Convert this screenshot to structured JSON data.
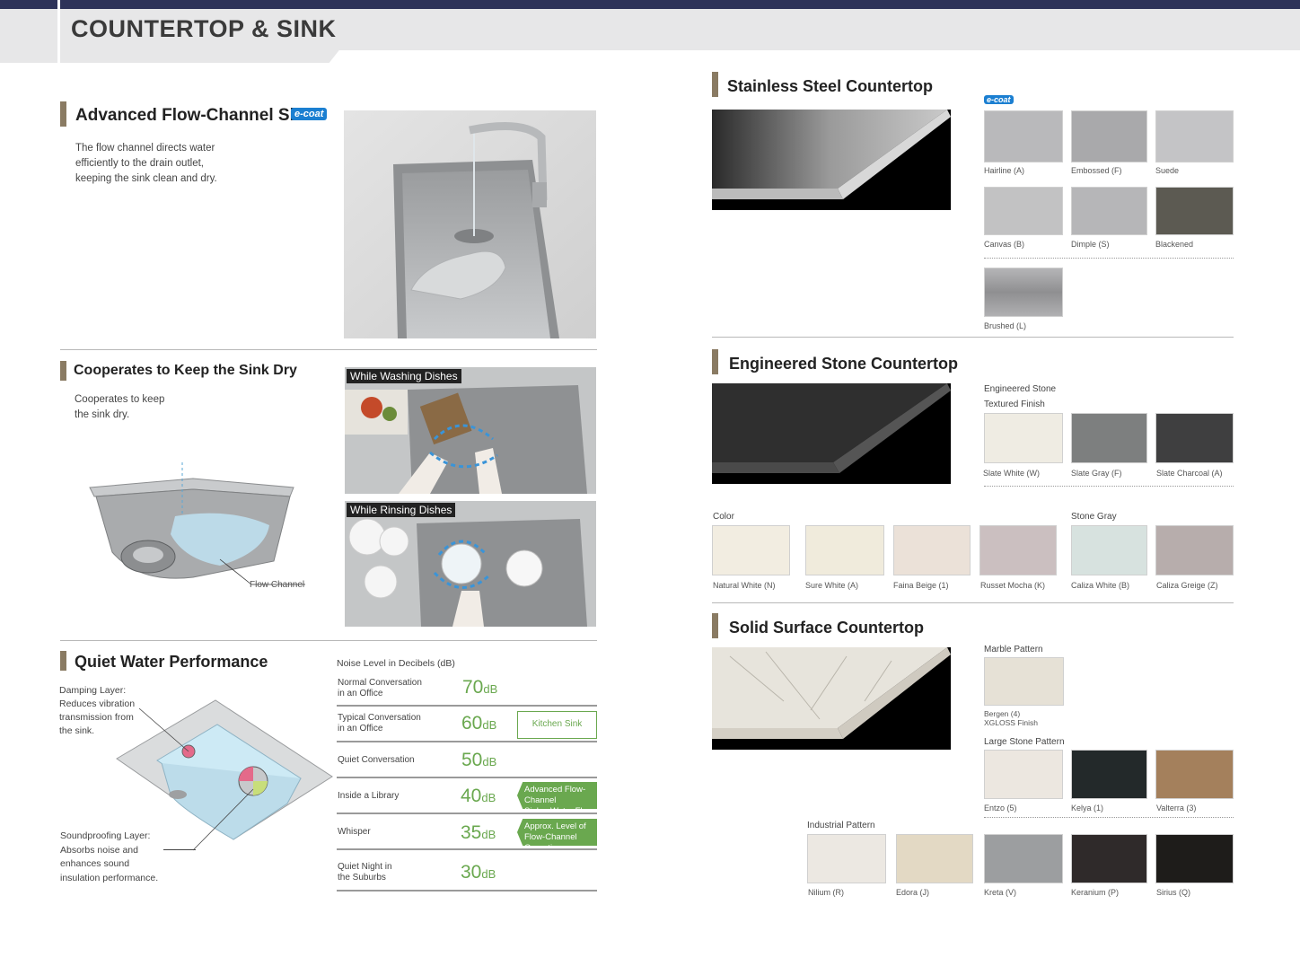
{
  "header": {
    "title": "COUNTERTOP & SINK"
  },
  "colors": {
    "accent_bar": "#8a7b63",
    "green": "#6aa84f",
    "ecoat_blue": "#1b7fd1",
    "top_bar": "#2e3359"
  },
  "flow_sink": {
    "title": "Advanced Flow-Channel Sink",
    "badge": "e-coat",
    "desc": [
      "The flow channel directs water",
      "efficiently to the drain outlet,",
      "keeping the sink clean and dry."
    ]
  },
  "keep_dry": {
    "title": "Cooperates to Keep the Sink Dry",
    "desc": [
      "Cooperates to keep",
      "the sink dry."
    ],
    "flow_channel_label": "Flow Channel",
    "photo1_label": "While Washing Dishes",
    "photo2_label": "While Rinsing Dishes"
  },
  "quiet": {
    "title": "Quiet Water Performance",
    "damping": [
      "Damping Layer:",
      "Reduces vibration",
      "transmission from",
      "the sink."
    ],
    "soundproof": [
      "Soundproofing Layer:",
      "Absorbs noise and",
      "enhances sound",
      "insulation performance."
    ],
    "table_title": "Noise Level in Decibels (dB)",
    "rows": [
      {
        "label": [
          "Normal Conversation",
          "in an Office"
        ],
        "value": "70",
        "unit": "dB"
      },
      {
        "label": [
          "Typical Conversation",
          "in an Office"
        ],
        "value": "60",
        "unit": "dB",
        "tag": "Kitchen Sink"
      },
      {
        "label": [
          "Quiet Conversation"
        ],
        "value": "50",
        "unit": "dB"
      },
      {
        "label": [
          "Inside a Library"
        ],
        "value": "40",
        "unit": "dB",
        "tag": [
          "Advanced Flow-Channel",
          "Sink – Water Flow"
        ]
      },
      {
        "label": [
          "Whisper"
        ],
        "value": "35",
        "unit": "dB",
        "tag": [
          "Approx. Level of",
          "Flow-Channel Operation"
        ]
      },
      {
        "label": [
          "Quiet Night in",
          "the Suburbs"
        ],
        "value": "30",
        "unit": "dB"
      }
    ]
  },
  "stainless": {
    "title": "Stainless Steel Countertop",
    "badge": "e-coat",
    "finishes": [
      {
        "name": "Hairline (A)",
        "color": "#b9b9bb"
      },
      {
        "name": "Embossed (F)",
        "color": "#a9a9ab"
      },
      {
        "name": "Suede",
        "color": "#c4c4c6"
      },
      {
        "name": "Canvas (B)",
        "color": "#c2c2c3"
      },
      {
        "name": "Dimple (S)",
        "color": "#b6b6b8"
      },
      {
        "name": "Blackened",
        "color": "#5c5a52"
      },
      {
        "name": "Brushed (L)",
        "color": "#a3a3a5"
      }
    ]
  },
  "engineered": {
    "title": "Engineered Stone Countertop",
    "sub": [
      "Engineered Stone",
      "Textured Finish"
    ],
    "textured": [
      {
        "name": "Slate White (W)",
        "color": "#efece3"
      },
      {
        "name": "Slate Gray (F)",
        "color": "#7d7f7f"
      },
      {
        "name": "Slate Charcoal (A)",
        "color": "#3f3f40"
      }
    ],
    "color_label": "Color",
    "stone_gray_label": "Stone Gray",
    "colors_list": [
      {
        "name": "Natural White (N)",
        "color": "#f2ede1"
      },
      {
        "name": "Sure White (A)",
        "color": "#f0ebdc"
      },
      {
        "name": "Faina Beige (1)",
        "color": "#ebe1d8"
      },
      {
        "name": "Russet Mocha (K)",
        "color": "#cbbfc0"
      },
      {
        "name": "Caliza White (B)",
        "color": "#d7e2df"
      },
      {
        "name": "Caliza Greige (Z)",
        "color": "#b7adac"
      }
    ]
  },
  "solid": {
    "title": "Solid Surface Countertop",
    "marble_label": "Marble Pattern",
    "marble": {
      "name": "Bergen (4)",
      "sub": "XGLOSS Finish",
      "color": "#e6e1d6"
    },
    "large_label": "Large Stone Pattern",
    "large": [
      {
        "name": "Entzo (5)",
        "color": "#ece7e0"
      },
      {
        "name": "Kelya (1)",
        "color": "#23292a"
      },
      {
        "name": "Valterra (3)",
        "color": "#a4805c"
      }
    ],
    "industrial_label": "Industrial Pattern",
    "industrial": [
      {
        "name": "Nilium (R)",
        "color": "#ece8e2"
      },
      {
        "name": "Edora (J)",
        "color": "#e3d9c4"
      },
      {
        "name": "Kreta (V)",
        "color": "#9c9ea0"
      },
      {
        "name": "Keranium (P)",
        "color": "#2f2a2a"
      },
      {
        "name": "Sirius (Q)",
        "color": "#1e1c1a"
      }
    ]
  }
}
